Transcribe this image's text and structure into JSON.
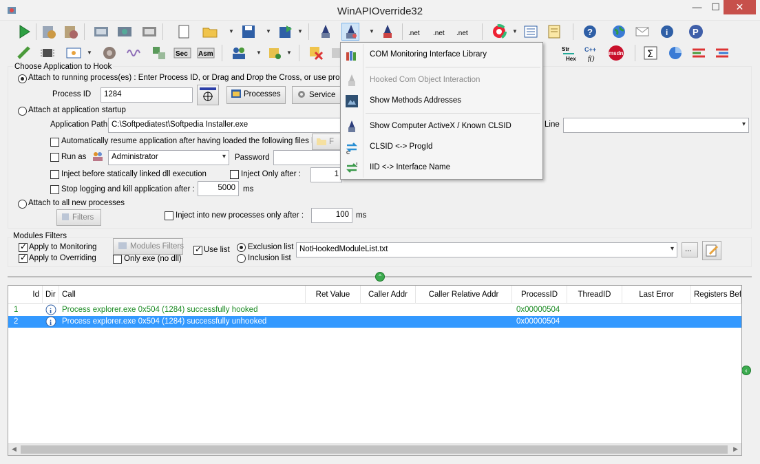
{
  "window": {
    "title": "WinAPIOverride32",
    "min": "—",
    "max": "☐",
    "close": "✕"
  },
  "hook": {
    "group_title": "Choose Application to Hook",
    "attach_running": "Attach to running process(es) : Enter Process ID, or Drag and Drop the Cross, or use processe",
    "process_id_label": "Process ID",
    "process_id_value": "1284",
    "processes_button": "Processes",
    "services_button": "Service",
    "attach_startup": "Attach at application startup",
    "app_path_label": "Application Path",
    "app_path_value": "C:\\Softpediatest\\Softpedia Installer.exe",
    "cmdline_label": "Line",
    "cmdline_value": "",
    "auto_resume": "Automatically resume application after having loaded the following files list",
    "files_button": "F",
    "run_as": "Run as",
    "run_as_user": "Administrator",
    "password_label": "Password",
    "inject_static": "Inject before statically linked dll execution",
    "inject_only_after": "Inject Only after :",
    "inject_only_value": "1",
    "stop_logging": "Stop logging and kill application after :",
    "stop_value": "5000",
    "ms1": "ms",
    "attach_all": "Attach to all new processes",
    "filters_button": "Filters",
    "inject_new_after": "Inject into new processes only after :",
    "inject_new_value": "100",
    "ms2": "ms"
  },
  "modules": {
    "group_title": "Modules Filters",
    "apply_monitoring": "Apply to Monitoring",
    "apply_overriding": "Apply to Overriding",
    "modules_filters_button": "Modules Filters",
    "only_exe": "Only exe (no dll)",
    "use_list": "Use list",
    "exclusion_list": "Exclusion list",
    "inclusion_list": "Inclusion list",
    "list_file": "NotHookedModuleList.txt",
    "browse": "..."
  },
  "log": {
    "columns": [
      "Id",
      "Dir",
      "Call",
      "Ret Value",
      "Caller Addr",
      "Caller Relative Addr",
      "ProcessID",
      "ThreadID",
      "Last Error",
      "Registers Befo"
    ],
    "rows": [
      {
        "id": "1",
        "call": "Process explorer.exe 0x504 (1284) successfully hooked",
        "pid": "0x00000504"
      },
      {
        "id": "2",
        "call": "Process explorer.exe 0x504 (1284) successfully unhooked",
        "pid": "0x00000504"
      }
    ]
  },
  "menu": {
    "items": [
      {
        "label": "COM Monitoring Interface Library",
        "icon": "books-icon",
        "enabled": true
      },
      {
        "label": "Hooked Com Object Interaction",
        "icon": "wizard-icon",
        "enabled": false
      },
      {
        "label": "Show Methods Addresses",
        "icon": "methods-icon",
        "enabled": true
      },
      {
        "label": "Show Computer ActiveX / Known CLSID",
        "icon": "wizard-icon",
        "enabled": true
      },
      {
        "label": "CLSID <-> ProgId",
        "icon": "swap-arrows-icon",
        "enabled": true
      },
      {
        "label": "IID <-> Interface Name",
        "icon": "swap-arrows-icon",
        "enabled": true
      }
    ]
  },
  "toolbar": {
    "sec": "Sec",
    "asm": "Asm",
    "net": ".net",
    "strhex_top": "Str",
    "strhex_bottom": "Hex",
    "msdn": "msdn",
    "sigma": "Σ"
  },
  "colors": {
    "selection": "#3399ff",
    "log_green": "#1a8a22",
    "close_red": "#c7504b"
  }
}
